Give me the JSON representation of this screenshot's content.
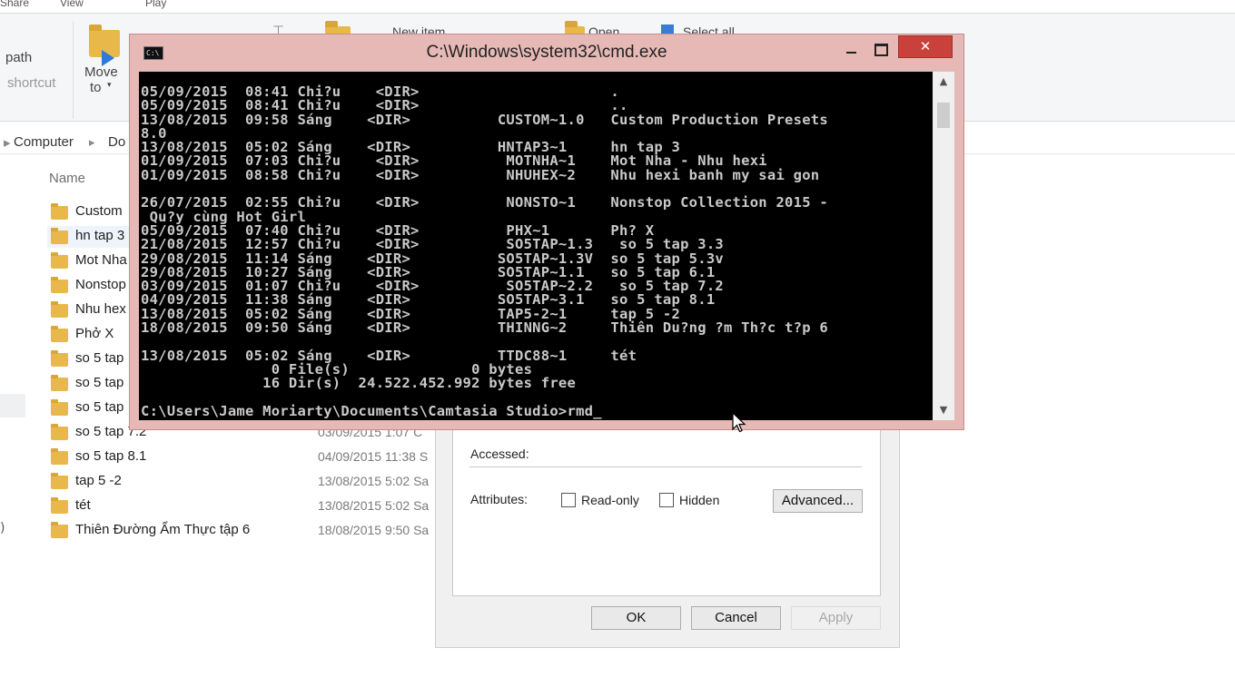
{
  "ribbon": {
    "tab_share": "Share",
    "tab_view": "View",
    "tab_play": "Play",
    "copy_path": "path",
    "paste_shortcut": "shortcut",
    "move_to_line1": "Move",
    "move_to_line2": "to",
    "new_item": "New item",
    "open": "Open",
    "select_all": "Select all"
  },
  "address": {
    "computer": "Computer",
    "documents": "Do",
    "separator": "▸"
  },
  "filelist": {
    "column_name": "Name",
    "rows": [
      {
        "name": "Custom",
        "date": ""
      },
      {
        "name": "hn tap 3",
        "date": ""
      },
      {
        "name": "Mot Nha",
        "date": ""
      },
      {
        "name": "Nonstop",
        "date": ""
      },
      {
        "name": "Nhu hex",
        "date": ""
      },
      {
        "name": "Phở X",
        "date": ""
      },
      {
        "name": "so 5 tap",
        "date": ""
      },
      {
        "name": "so 5 tap",
        "date": ""
      },
      {
        "name": "so 5 tap",
        "date": ""
      },
      {
        "name": "so 5 tap 7.2",
        "date": "03/09/2015 1:07 C"
      },
      {
        "name": "so 5 tap 8.1",
        "date": "04/09/2015 11:38 S"
      },
      {
        "name": "tap 5 -2",
        "date": "13/08/2015 5:02 Sa"
      },
      {
        "name": "tét",
        "date": "13/08/2015 5:02 Sa"
      },
      {
        "name": "Thiên Đường Ẩm Thực tập 6",
        "date": "18/08/2015 9:50 Sa"
      }
    ]
  },
  "properties": {
    "accessed_label": "Accessed:",
    "attributes_label": "Attributes:",
    "readonly_label": "Read-only",
    "hidden_label": "Hidden",
    "advanced_button": "Advanced...",
    "ok_button": "OK",
    "cancel_button": "Cancel",
    "apply_button": "Apply"
  },
  "cmd": {
    "title": "C:\\Windows\\system32\\cmd.exe",
    "icon_text": "C:\\",
    "close_glyph": "✕",
    "lines": [
      "05/09/2015  08:41 Chi?u    <DIR>                      .",
      "05/09/2015  08:41 Chi?u    <DIR>                      ..",
      "13/08/2015  09:58 Sáng    <DIR>          CUSTOM~1.0   Custom Production Presets",
      "8.0",
      "13/08/2015  05:02 Sáng    <DIR>          HNTAP3~1     hn tap 3",
      "01/09/2015  07:03 Chi?u    <DIR>          MOTNHA~1    Mot Nha - Nhu hexi",
      "01/09/2015  08:58 Chi?u    <DIR>          NHUHEX~2    Nhu hexi banh my sai gon",
      "",
      "26/07/2015  02:55 Chi?u    <DIR>          NONSTO~1    Nonstop Collection 2015 -",
      " Qu?y cùng Hot Girl",
      "05/09/2015  07:40 Chi?u    <DIR>          PHX~1       Ph? X",
      "21/08/2015  12:57 Chi?u    <DIR>          SO5TAP~1.3   so 5 tap 3.3",
      "29/08/2015  11:14 Sáng    <DIR>          SO5TAP~1.3V  so 5 tap 5.3v",
      "29/08/2015  10:27 Sáng    <DIR>          SO5TAP~1.1   so 5 tap 6.1",
      "03/09/2015  01:07 Chi?u    <DIR>          SO5TAP~2.2   so 5 tap 7.2",
      "04/09/2015  11:38 Sáng    <DIR>          SO5TAP~3.1   so 5 tap 8.1",
      "13/08/2015  05:02 Sáng    <DIR>          TAP5-2~1     tap 5 -2",
      "18/08/2015  09:50 Sáng    <DIR>          THINNG~2     Thiên Du?ng ?m Th?c t?p 6",
      "",
      "13/08/2015  05:02 Sáng    <DIR>          TTDC88~1     tét",
      "               0 File(s)              0 bytes",
      "              16 Dir(s)  24.522.452.992 bytes free",
      "",
      "C:\\Users\\Jame Moriarty\\Documents\\Camtasia Studio>rmd_"
    ]
  }
}
